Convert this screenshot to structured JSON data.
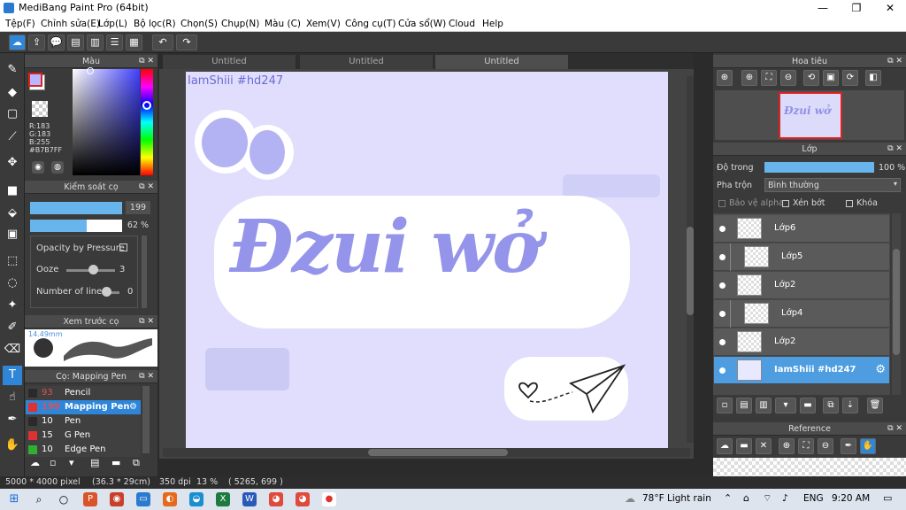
{
  "window": {
    "title": "MediBang Paint Pro (64bit)",
    "min": "—",
    "max": "❐",
    "close": "✕"
  },
  "menu": [
    "Tệp(F)",
    "Chỉnh sửa(E)",
    "Lớp(L)",
    "Bộ lọc(R)",
    "Chọn(S)",
    "Chụp(N)",
    "Màu (C)",
    "Xem(V)",
    "Công cụ(T)",
    "Cửa sổ(W)",
    "Cloud",
    "Help"
  ],
  "color_panel": {
    "title": "Màu",
    "r": "R:183",
    "g": "G:183",
    "b": "B:255",
    "hex": "#B7B7FF"
  },
  "brush_control": {
    "title": "Kiểm soát cọ",
    "size_value": "199",
    "opacity_value": "62 %",
    "opacity_fill": 0.62,
    "opacity_pressure": "Opacity by Pressure",
    "ooze_label": "Ooze",
    "ooze_value": "3",
    "lines_label": "Number of lines",
    "lines_value": "0"
  },
  "brush_preview": {
    "title": "Xem trước cọ",
    "size": "14.49mm"
  },
  "brush_list": {
    "title": "Cọ: Mapping Pen",
    "items": [
      {
        "size": "93",
        "name": "Pencil",
        "color": "#2a2a2a",
        "size_color": "#e05050"
      },
      {
        "size": "199",
        "name": "Mapping Pen",
        "color": "#e03030",
        "size_color": "#e05050"
      },
      {
        "size": "10",
        "name": "Pen",
        "color": "#2a2a2a",
        "size_color": "#ffffff"
      },
      {
        "size": "15",
        "name": "G Pen",
        "color": "#e03030",
        "size_color": "#ffffff"
      },
      {
        "size": "10",
        "name": "Edge Pen",
        "color": "#30b030",
        "size_color": "#ffffff"
      }
    ]
  },
  "tabs": [
    "Untitled",
    "Untitled",
    "Untitled"
  ],
  "canvas": {
    "watermark": "IamShiii #hd247",
    "main_text": "Đzui wở"
  },
  "navigator": {
    "title": "Hoa tiêu",
    "thumb_text": "Đzui wở"
  },
  "layer_panel": {
    "title": "Lớp",
    "opacity_label": "Độ trong",
    "opacity_value": "100 %",
    "blend_label": "Pha trộn",
    "blend_value": "Bình thường",
    "protect_alpha": "Bảo vệ alpha",
    "clip": "Xén bớt",
    "lock": "Khóa",
    "layers": [
      {
        "name": "Lớp6",
        "indent": false,
        "selected": false
      },
      {
        "name": "Lớp5",
        "indent": true,
        "selected": false
      },
      {
        "name": "Lớp2",
        "indent": false,
        "selected": false
      },
      {
        "name": "Lớp4",
        "indent": true,
        "selected": false
      },
      {
        "name": "Lớp2",
        "indent": false,
        "selected": false
      },
      {
        "name": "IamShiii #hd247",
        "indent": false,
        "selected": true
      }
    ]
  },
  "reference": {
    "title": "Reference"
  },
  "status": {
    "dims": "5000 * 4000 pixel",
    "cm": "(36.3 * 29cm)",
    "dpi": "350 dpi",
    "zoom": "13 %",
    "coords": "( 5265, 699 )"
  },
  "taskbar": {
    "weather": "78°F  Light rain",
    "lang": "ENG",
    "time": "9:20 AM"
  }
}
